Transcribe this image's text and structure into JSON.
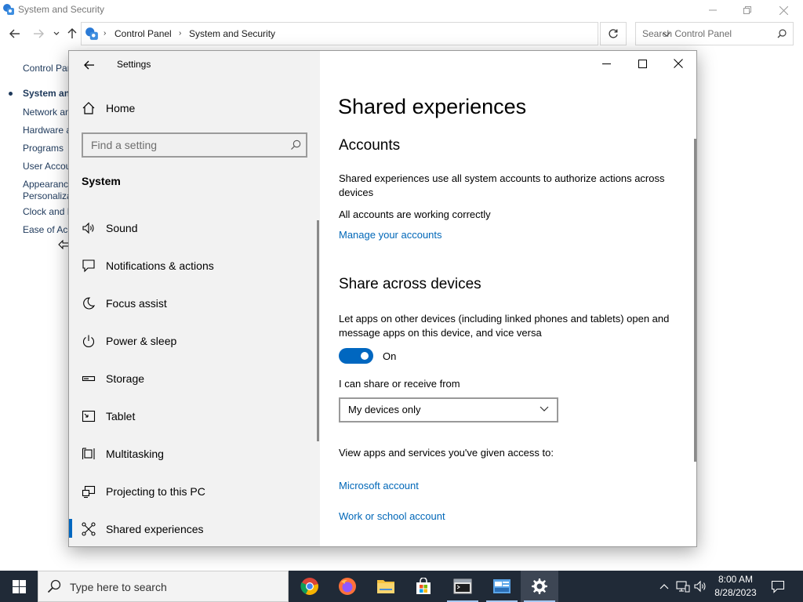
{
  "control_panel": {
    "title": "System and Security",
    "breadcrumb": [
      "Control Panel",
      "System and Security"
    ],
    "search_placeholder": "Search Control Panel",
    "sidebar_links": [
      {
        "label": "Control Panel Home",
        "active": false
      },
      {
        "label": "System and Security",
        "active": true
      },
      {
        "label": "Network and Internet",
        "active": false
      },
      {
        "label": "Hardware and Sound",
        "active": false
      },
      {
        "label": "Programs",
        "active": false
      },
      {
        "label": "User Accounts",
        "active": false
      },
      {
        "label": "Appearance and",
        "label2": "Personalization",
        "active": false
      },
      {
        "label": "Clock and Region",
        "active": false
      },
      {
        "label": "Ease of Access",
        "active": false
      }
    ]
  },
  "settings": {
    "window_title": "Settings",
    "home_label": "Home",
    "search_placeholder": "Find a setting",
    "group_label": "System",
    "nav_items": [
      {
        "label": "Sound",
        "icon": "speaker-icon"
      },
      {
        "label": "Notifications & actions",
        "icon": "notification-icon"
      },
      {
        "label": "Focus assist",
        "icon": "moon-icon"
      },
      {
        "label": "Power & sleep",
        "icon": "power-icon"
      },
      {
        "label": "Storage",
        "icon": "storage-icon"
      },
      {
        "label": "Tablet",
        "icon": "tablet-icon"
      },
      {
        "label": "Multitasking",
        "icon": "multitasking-icon"
      },
      {
        "label": "Projecting to this PC",
        "icon": "projector-icon"
      },
      {
        "label": "Shared experiences",
        "icon": "shared-experiences-icon",
        "selected": true
      }
    ],
    "page": {
      "heading": "Shared experiences",
      "accounts_title": "Accounts",
      "accounts_desc": "Shared experiences use all system accounts to authorize actions across devices",
      "accounts_status": "All accounts are working correctly",
      "manage_link": "Manage your accounts",
      "share_title": "Share across devices",
      "share_desc": "Let apps on other devices (including linked phones and tablets) open and message apps on this device, and vice versa",
      "toggle_state": "On",
      "toggle_on": true,
      "share_from_label": "I can share or receive from",
      "share_from_value": "My devices only",
      "access_label": "View apps and services you've given access to:",
      "microsoft_link": "Microsoft account",
      "work_link": "Work or school account"
    }
  },
  "taskbar": {
    "search_placeholder": "Type here to search",
    "apps": [
      "chrome-icon",
      "firefox-icon",
      "file-explorer-icon",
      "store-icon",
      "terminal-icon",
      "control-panel-icon",
      "settings-gear-icon"
    ],
    "active_app": "settings-gear-icon",
    "time": "8:00 AM",
    "date": "8/28/2023"
  },
  "colors": {
    "accent": "#0067c0",
    "link": "#0067b8",
    "taskbar": "#202a37",
    "nav_bg": "#f2f2f2"
  }
}
